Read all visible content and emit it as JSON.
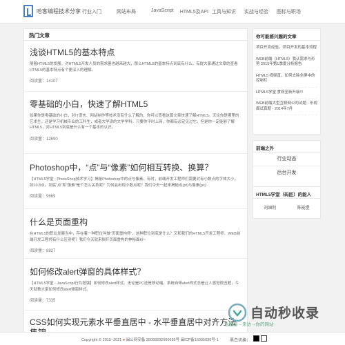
{
  "header": {
    "site_name": "哈客编程技术分享",
    "nav": [
      "行业入门",
      "网站布局",
      "JavaScript",
      "HTML5及API",
      "工具与知识",
      "实战与经验",
      "图标与职场"
    ]
  },
  "main": {
    "title": "热门文章",
    "articles": [
      {
        "title": "浅谈HTML5的基本特点",
        "summary": "随着HTML5的发展，对HTML5开发人员的需求量也越来越大，那么HTML5的基本特点到底有什么，有提大家通过文章的查看HTML5的基本特点有个更深入的理解。",
        "reads": "阅读量：14107"
      },
      {
        "title": "零基础的小白，快速了解HTML5",
        "summary": "如果你是零基础的小白，对IT语言、网站制作等技术没有什么了解的，你可以查看这篇文章快速了解HTML5。无论你是哪里的艺术生，还是学习机械专业的工科生，或者大学读的文学学科。只要你平时上网，你都有必定见过它，但是你一定能够了解HTML5，对HTML5到底是什么有一个基本的认识。",
        "reads": "阅读量：12690"
      },
      {
        "title": "Photoshop中，“点”与“像素”如何相互转换、换算？",
        "summary": "【HTML5学堂 - PhotoShop技术学习】揭秘Photoshop中的点与像素。有时，前端开发工程师们需要对有小数点的字体大小，如10.8点。到底“点”和“像素”是个怎么关系呢？为何会出现小数点呢？我们今天一起来揭秘点(pt)与像素(px)",
        "reads": "阅读量：9669"
      },
      {
        "title": "什么是页面重构",
        "summary": "在HTML5的职业发展当中，存在着一种职位叫做“页面重构师”，这种职位到底是什么？又和我们的HTML5开发工程师、WEB前端开发工程师有什么区别呢？我们今天就来揭开页面重构的神秘面纱~",
        "reads": "阅读量：8827"
      },
      {
        "title": "如何修改alert弹窗的具体样式？",
        "summary": "【HTML5学堂 - JavaScript行为增强】如何修改alert样式。无论是PC还是移动端，系统自带alert样式总是让人感觉很丑陋，今天就教大家如何修改alert弹窗样式。",
        "reads": "阅读量：7335"
      },
      {
        "title": "CSS如何实现元素水平垂直居中 - 水平垂直居中对齐方法集锦",
        "summary": "",
        "reads": ""
      }
    ]
  },
  "sidebar": {
    "hot_title": "你可能感兴趣的文章",
    "hot_items": [
      "项目开发经验，项目开发的基本流程",
      "WEB前端（HTML5）我认需求与形势 2015年第1季度分析报告",
      "HTML5 视频直，如何去除全屏中的控制栏",
      "HTML5学堂 食网全新升级!!!",
      "WEB前端大型互联网公司试题 - 乐视面试真题 - 2014年7月"
    ],
    "ext_title": "前端之外",
    "ext_items": [
      "行业动态",
      "后台开发"
    ],
    "authors_title": "HTML5学堂（码匠）的能人",
    "authors": [
      "刘国利",
      "陈能堡"
    ]
  },
  "footer": {
    "copyright": "Copyright © 2015~2021",
    "police": "闽公网安备 35058202000655号",
    "icp": "闽ICP备15005630号-1",
    "switch_label": "黑白切换："
  },
  "watermark": {
    "text": "自动秒收录",
    "sub": "让链接→来访→你的网站"
  },
  "colors": {
    "accent": "#4a7fc0",
    "background": "#f2f2f2"
  }
}
